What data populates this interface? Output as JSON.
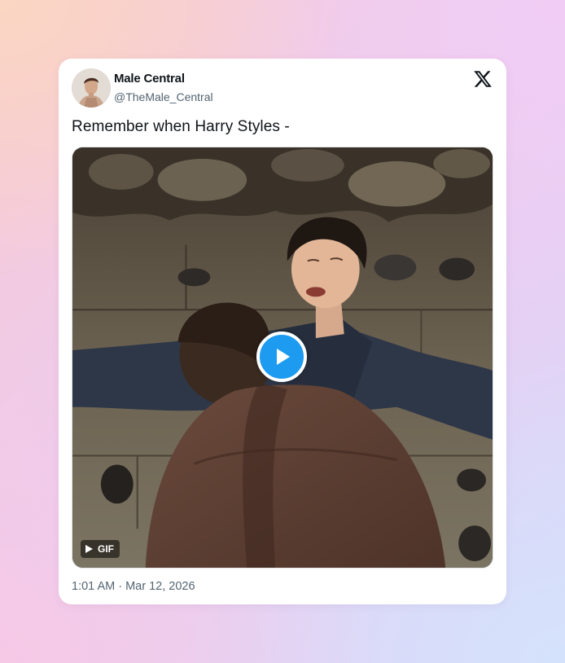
{
  "tweet": {
    "display_name": "Male Central",
    "handle": "@TheMale_Central",
    "text": "Remember when Harry Styles -",
    "timestamp": "1:01 AM · Mar 12, 2026",
    "media_badge": "GIF",
    "brand_icon": "x-logo-icon",
    "play_icon": "play-icon",
    "accent_color": "#1d9bf0"
  }
}
